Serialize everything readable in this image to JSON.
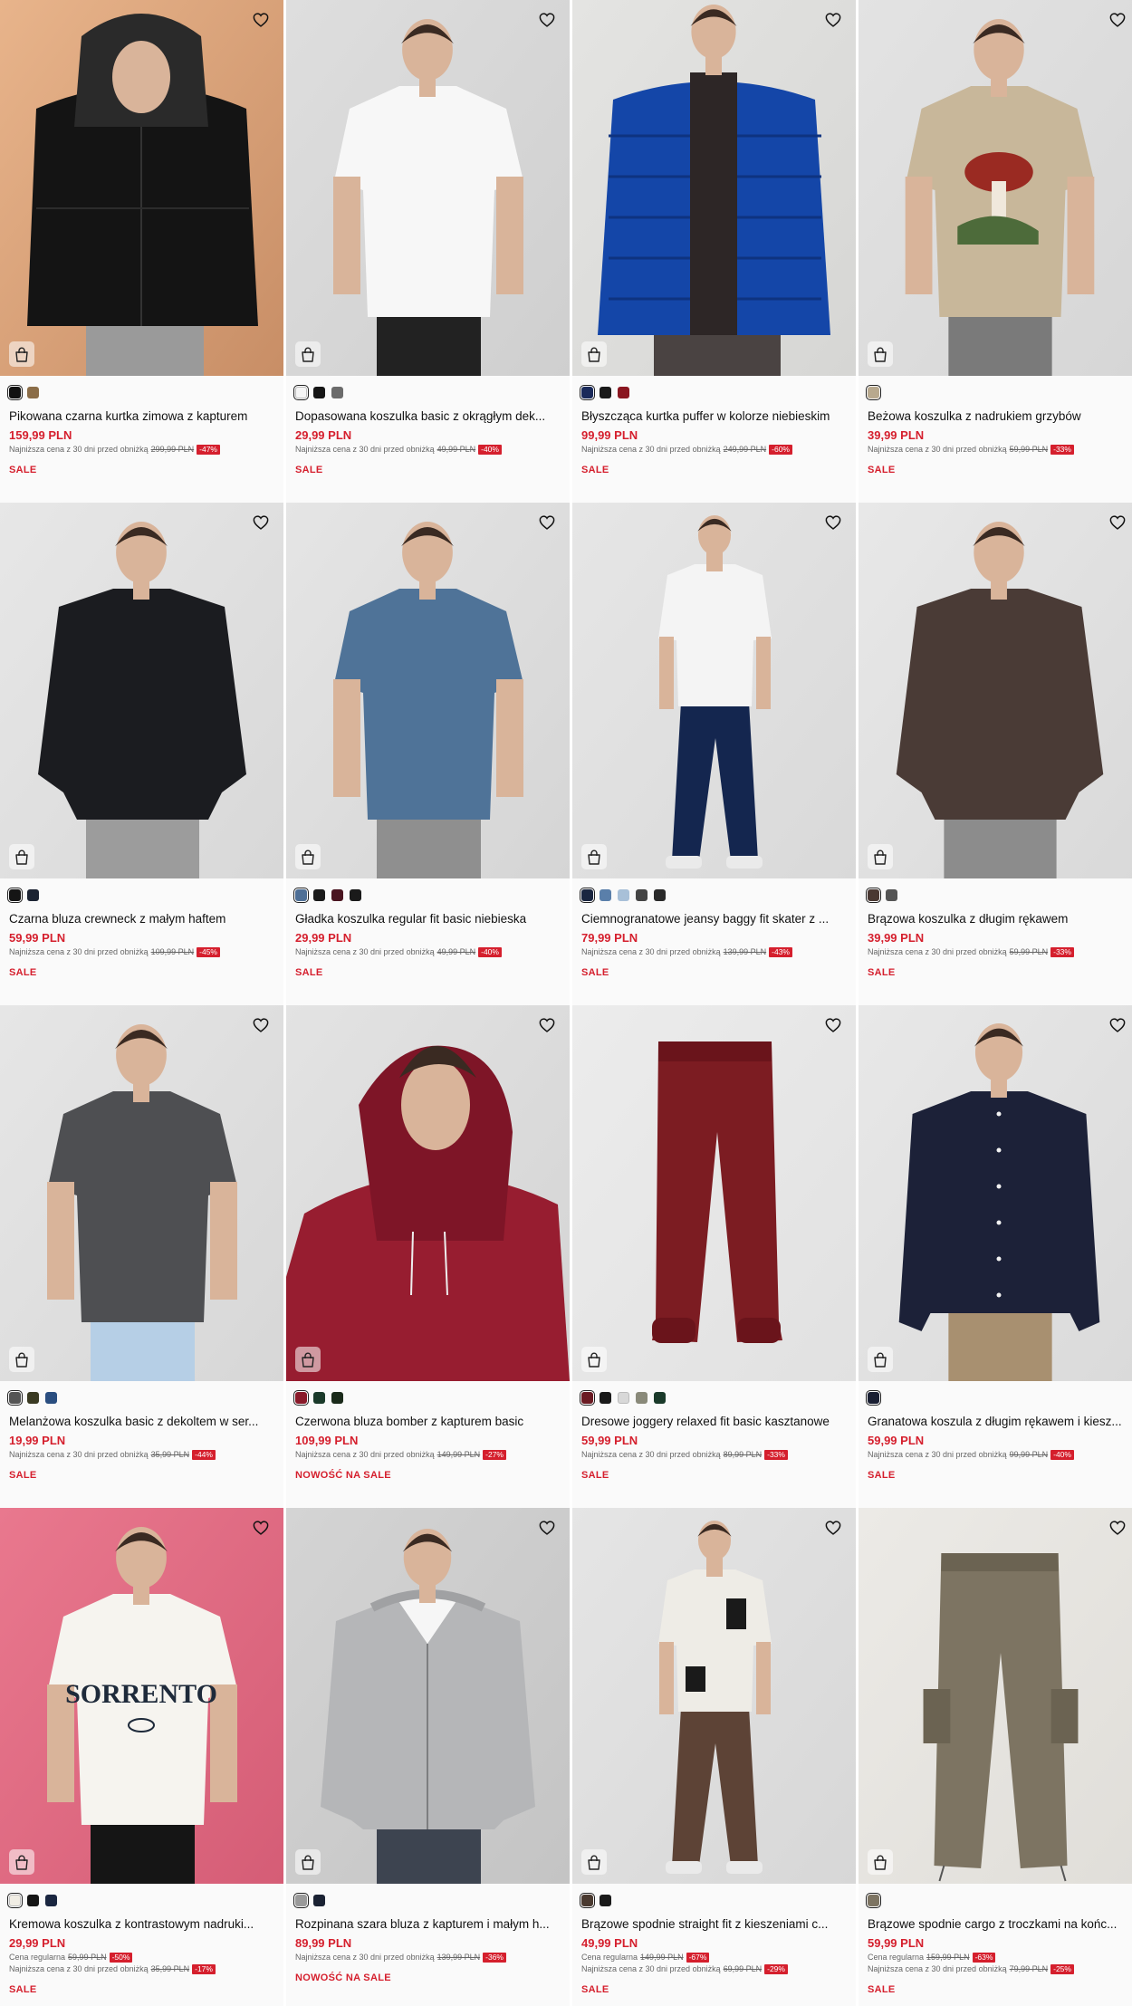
{
  "colors": {
    "accent": "#d51f2d",
    "text": "#111111",
    "muted": "#666666"
  },
  "icons": {
    "favorite": "heart-outline-icon",
    "cart": "shopping-bag-icon"
  },
  "products": [
    {
      "name": "Pikowana czarna kurtka zimowa z kapturem",
      "price": "159,99 PLN",
      "omnibus": [
        {
          "label": "Najniższa cena z 30 dni przed obniżką",
          "old": "299,99 PLN",
          "discount": "-47%"
        }
      ],
      "badge": "SALE",
      "swatches": [
        "#111111",
        "#8b6d48"
      ],
      "image": {
        "bg": "#e8b48b",
        "bg2": "#c88e66",
        "garment": "#141414",
        "accent": "#2a2a2a",
        "lower": "#9a9a9a",
        "type": "jacket"
      }
    },
    {
      "name": "Dopasowana koszulka basic z okrągłym dek...",
      "price": "29,99 PLN",
      "omnibus": [
        {
          "label": "Najniższa cena z 30 dni przed obniżką",
          "old": "49,99 PLN",
          "discount": "-40%"
        }
      ],
      "badge": "SALE",
      "swatches": [
        "#f5f5f5",
        "#151515",
        "#6b6b6b"
      ],
      "image": {
        "bg": "#dedede",
        "bg2": "#cfcfcf",
        "garment": "#f7f7f7",
        "accent": "#e6e6e6",
        "lower": "#222222",
        "type": "tee"
      }
    },
    {
      "name": "Błyszcząca kurtka puffer w kolorze niebieskim",
      "price": "99,99 PLN",
      "omnibus": [
        {
          "label": "Najniższa cena z 30 dni przed obniżką",
          "old": "249,99 PLN",
          "discount": "-60%"
        }
      ],
      "badge": "SALE",
      "swatches": [
        "#1a2a5a",
        "#1a1a1a",
        "#8a1620"
      ],
      "image": {
        "bg": "#e4e4e2",
        "bg2": "#d6d6d4",
        "garment": "#1446a8",
        "accent": "#2d2626",
        "lower": "#4a4342",
        "type": "puffer"
      }
    },
    {
      "name": "Beżowa koszulka z nadrukiem grzybów",
      "price": "39,99 PLN",
      "omnibus": [
        {
          "label": "Najniższa cena z 30 dni przed obniżką",
          "old": "59,99 PLN",
          "discount": "-33%"
        }
      ],
      "badge": "SALE",
      "swatches": [
        "#b8a98e"
      ],
      "image": {
        "bg": "#e3e3e3",
        "bg2": "#d6d6d6",
        "garment": "#c8b79a",
        "accent": "#9a2a22",
        "lower": "#7a7a7a",
        "type": "printtee"
      }
    },
    {
      "name": "Czarna bluza crewneck z małym haftem",
      "price": "59,99 PLN",
      "omnibus": [
        {
          "label": "Najniższa cena z 30 dni przed obniżką",
          "old": "109,99 PLN",
          "discount": "-45%"
        }
      ],
      "badge": "SALE",
      "swatches": [
        "#151515",
        "#1c2433"
      ],
      "image": {
        "bg": "#e7e7e7",
        "bg2": "#d8d8d8",
        "garment": "#1b1c20",
        "accent": "#26272b",
        "lower": "#9c9c9c",
        "type": "sweat"
      }
    },
    {
      "name": "Gładka koszulka regular fit basic niebieska",
      "price": "29,99 PLN",
      "omnibus": [
        {
          "label": "Najniższa cena z 30 dni przed obniżką",
          "old": "49,99 PLN",
          "discount": "-40%"
        }
      ],
      "badge": "SALE",
      "swatches": [
        "#4e6f96",
        "#1a1a1a",
        "#4a1420",
        "#1a1a1a"
      ],
      "image": {
        "bg": "#e5e5e5",
        "bg2": "#d5d5d5",
        "garment": "#4f7398",
        "accent": "#5b7fa3",
        "lower": "#8f8f8f",
        "type": "tee"
      }
    },
    {
      "name": "Ciemnogranatowe jeansy baggy fit skater z ...",
      "price": "79,99 PLN",
      "omnibus": [
        {
          "label": "Najniższa cena z 30 dni przed obniżką",
          "old": "139,99 PLN",
          "discount": "-43%"
        }
      ],
      "badge": "SALE",
      "swatches": [
        "#1a2640",
        "#5a7faa",
        "#a8c0d8",
        "#444444",
        "#2a2a2a"
      ],
      "image": {
        "bg": "#e6e6e6",
        "bg2": "#d9d9d9",
        "garment": "#f4f4f4",
        "accent": "#eeeeee",
        "lower": "#14264f",
        "type": "fullbody"
      }
    },
    {
      "name": "Brązowa koszulka z długim rękawem",
      "price": "39,99 PLN",
      "omnibus": [
        {
          "label": "Najniższa cena z 30 dni przed obniżką",
          "old": "59,99 PLN",
          "discount": "-33%"
        }
      ],
      "badge": "SALE",
      "swatches": [
        "#4a3832",
        "#555555"
      ],
      "image": {
        "bg": "#e8e8e8",
        "bg2": "#d9d9d9",
        "garment": "#4a3b36",
        "accent": "#574640",
        "lower": "#8c8c8c",
        "type": "sweat"
      }
    },
    {
      "name": "Melanżowa koszulka basic z dekoltem w ser...",
      "price": "19,99 PLN",
      "omnibus": [
        {
          "label": "Najniższa cena z 30 dni przed obniżką",
          "old": "35,99 PLN",
          "discount": "-44%"
        }
      ],
      "badge": "SALE",
      "swatches": [
        "#555555",
        "#3a3a22",
        "#2a4e80"
      ],
      "image": {
        "bg": "#e6e6e6",
        "bg2": "#d7d7d7",
        "garment": "#4e4f52",
        "accent": "#5a5b5e",
        "lower": "#b6cfe6",
        "type": "tee"
      }
    },
    {
      "name": "Czerwona bluza bomber z kapturem basic",
      "price": "109,99 PLN",
      "omnibus": [
        {
          "label": "Najniższa cena z 30 dni przed obniżką",
          "old": "149,99 PLN",
          "discount": "-27%"
        }
      ],
      "badge": "NOWOŚĆ NA SALE",
      "swatches": [
        "#8a1a2a",
        "#1a3a2a",
        "#1a2a1a"
      ],
      "image": {
        "bg": "#e3e3e3",
        "bg2": "#d4d4d4",
        "garment": "#971d30",
        "accent": "#7e1527",
        "lower": "#971d30",
        "type": "hoodie"
      }
    },
    {
      "name": "Dresowe joggery relaxed fit basic kasztanowe",
      "price": "59,99 PLN",
      "omnibus": [
        {
          "label": "Najniższa cena z 30 dni przed obniżką",
          "old": "89,99 PLN",
          "discount": "-33%"
        }
      ],
      "badge": "SALE",
      "swatches": [
        "#6a1a22",
        "#1a1a1a",
        "#d8d8d8",
        "#8a8a7a",
        "#1a3a2a"
      ],
      "image": {
        "bg": "#ececec",
        "bg2": "#e1e1e1",
        "garment": "#7c1c22",
        "accent": "#6a141b",
        "lower": "#7c1c22",
        "type": "pants"
      }
    },
    {
      "name": "Granatowa koszula z długim rękawem i kiesz...",
      "price": "59,99 PLN",
      "omnibus": [
        {
          "label": "Najniższa cena z 30 dni przed obniżką",
          "old": "99,99 PLN",
          "discount": "-40%"
        }
      ],
      "badge": "SALE",
      "swatches": [
        "#1a1f33"
      ],
      "image": {
        "bg": "#e8e8e8",
        "bg2": "#dadada",
        "garment": "#1c2138",
        "accent": "#f2f2f2",
        "lower": "#a89070",
        "type": "shirt"
      }
    },
    {
      "name": "Kremowa koszulka z kontrastowym nadruki...",
      "price": "29,99 PLN",
      "omnibus": [
        {
          "label": "Cena regularna",
          "old": "59,99 PLN",
          "discount": "-50%"
        },
        {
          "label": "Najniższa cena z 30 dni przed obniżką",
          "old": "35,99 PLN",
          "discount": "-17%"
        }
      ],
      "badge": "SALE",
      "swatches": [
        "#f0ede4",
        "#151515",
        "#1a2640"
      ],
      "image": {
        "bg": "#e9788e",
        "bg2": "#d55d76",
        "garment": "#f6f4ef",
        "accent": "#1e2a3a",
        "lower": "#151515",
        "type": "logotee",
        "print": "SORRENTO"
      }
    },
    {
      "name": "Rozpinana szara bluza z kapturem i małym h...",
      "price": "89,99 PLN",
      "omnibus": [
        {
          "label": "Najniższa cena z 30 dni przed obniżką",
          "old": "139,99 PLN",
          "discount": "-36%"
        }
      ],
      "badge": "NOWOŚĆ NA SALE",
      "swatches": [
        "#9a9a9a",
        "#1a2233"
      ],
      "image": {
        "bg": "#d4d4d4",
        "bg2": "#c4c4c4",
        "garment": "#b5b6b8",
        "accent": "#f6f6f6",
        "lower": "#3d4450",
        "type": "ziphoodie"
      }
    },
    {
      "name": "Brązowe spodnie straight fit z kieszeniami c...",
      "price": "49,99 PLN",
      "omnibus": [
        {
          "label": "Cena regularna",
          "old": "149,99 PLN",
          "discount": "-67%"
        },
        {
          "label": "Najniższa cena z 30 dni przed obniżką",
          "old": "69,99 PLN",
          "discount": "-29%"
        }
      ],
      "badge": "SALE",
      "swatches": [
        "#4a3a30",
        "#1a1a1a"
      ],
      "image": {
        "bg": "#e5e5e5",
        "bg2": "#d7d7d7",
        "garment": "#eeece6",
        "accent": "#1a1a1a",
        "lower": "#5d4336",
        "type": "fullbody"
      }
    },
    {
      "name": "Brązowe spodnie cargo z troczkami na końc...",
      "price": "59,99 PLN",
      "omnibus": [
        {
          "label": "Cena regularna",
          "old": "159,99 PLN",
          "discount": "-63%"
        },
        {
          "label": "Najniższa cena z 30 dni przed obniżką",
          "old": "79,99 PLN",
          "discount": "-25%"
        }
      ],
      "badge": "SALE",
      "swatches": [
        "#7d7462"
      ],
      "image": {
        "bg": "#eceae6",
        "bg2": "#e0ded9",
        "garment": "#7d7462",
        "accent": "#6b6352",
        "lower": "#7d7462",
        "type": "cargo"
      }
    }
  ]
}
